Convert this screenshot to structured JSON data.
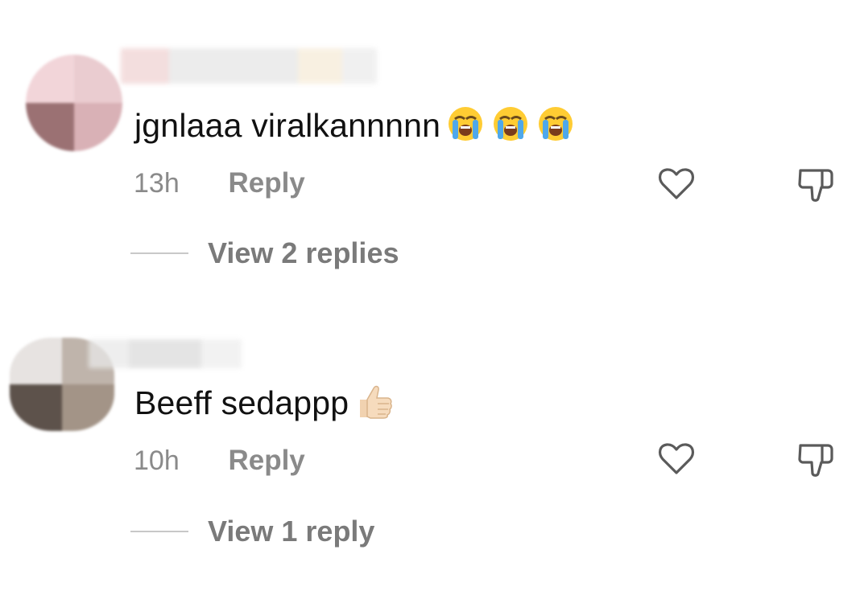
{
  "comments": [
    {
      "text": "jgnlaaa viralkannnnn",
      "emojis": [
        "loudly-crying-face",
        "loudly-crying-face",
        "loudly-crying-face"
      ],
      "time": "13h",
      "reply_label": "Reply",
      "view_replies_label": "View 2 replies"
    },
    {
      "text": "Beeff sedappp",
      "emojis": [
        "thumbs-up-light-skin-tone"
      ],
      "time": "10h",
      "reply_label": "Reply",
      "view_replies_label": "View 1 reply"
    }
  ],
  "colors": {
    "text": "#111111",
    "muted": "#8a8a8a",
    "icon_stroke": "#5a5a5a",
    "divider": "#c8c8c8"
  }
}
